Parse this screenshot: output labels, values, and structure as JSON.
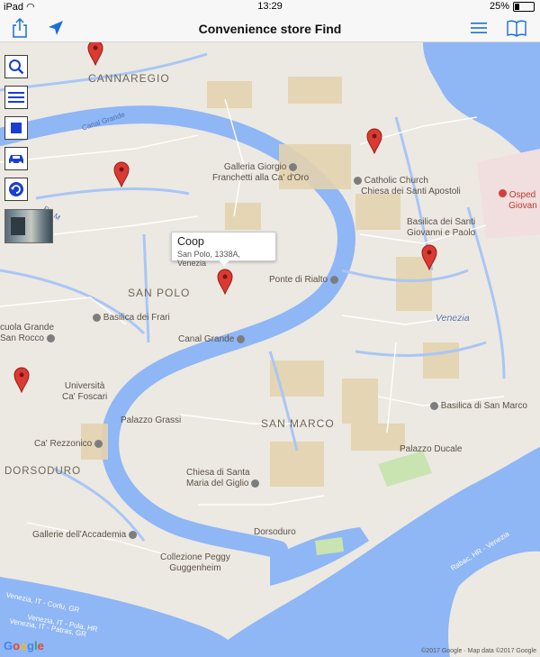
{
  "status_bar": {
    "device": "iPad",
    "time": "13:29",
    "battery": "25%",
    "battery_level": 0.25
  },
  "nav": {
    "title": "Convenience store Find"
  },
  "icons": {
    "share": "share-icon",
    "locate": "location-arrow-icon",
    "menu": "hamburger-menu-icon",
    "book": "book-icon",
    "search": "search-icon",
    "list": "list-icon",
    "square": "square-icon",
    "car": "car-icon",
    "redo": "rotate-icon"
  },
  "colors": {
    "ios_blue": "#1b6dd8",
    "water": "#8fb6f5",
    "land": "#ece9e2",
    "pin": "#d93a32"
  },
  "tooltip": {
    "name": "Coop",
    "address": "San Polo, 1338A, Venezia"
  },
  "map_labels": {
    "cannaregio": "CANNAREGIO",
    "san_polo": "SAN POLO",
    "san_marco": "SAN MARCO",
    "dorsoduro": "DORSODURO",
    "galleria_1": "Galleria Giorgio",
    "galleria_2": "Franchetti alla Ca' d'Oro",
    "catholic_1": "Catholic Church",
    "catholic_2": "Chiesa dei Santi Apostoli",
    "basilica_santi_1": "Basilica dei Santi",
    "basilica_santi_2": "Giovanni e Paolo",
    "ospedale_1": "Osped",
    "ospedale_2": "Giovan",
    "ponte_rialto": "Ponte di Rialto",
    "frari": "Basilica dei Frari",
    "scuola_1": "cuola Grande",
    "scuola_2": "San Rocco",
    "canal_grande_poi": "Canal Grande",
    "venezia": "Venezia",
    "universita_1": "Università",
    "universita_2": "Ca' Foscari",
    "palazzo_grassi": "Palazzo Grassi",
    "basilica_marco": "Basilica di San Marco",
    "ca_rezzonico": "Ca' Rezzonico",
    "palazzo_ducale": "Palazzo Ducale",
    "santa_maria_1": "Chiesa di Santa",
    "santa_maria_2": "Maria del Giglio",
    "gallerie": "Gallerie dell'Accademia",
    "dorsoduro_poi": "Dorsoduro",
    "collezione_1": "Collezione Peggy",
    "collezione_2": "Guggenheim",
    "canal_grande_water": "Canal Grande",
    "rio_label": "Rio M",
    "route_1": "Venezia, IT - Corfu, GR",
    "route_2": "Venezia, IT - Patras, GR",
    "route_3": "Venezia, IT - Pula, HR",
    "route_4": "Rabac, HR - Venezia"
  },
  "footer": {
    "google": "Google",
    "credits": "©2017 Google · Map data ©2017 Google"
  }
}
